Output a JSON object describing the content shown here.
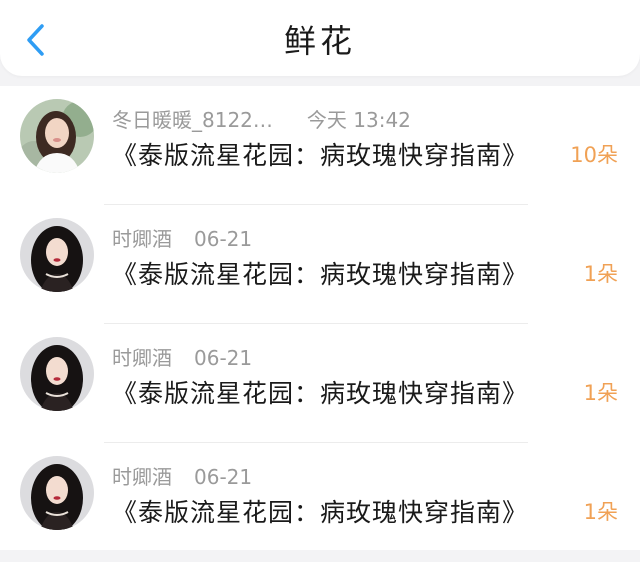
{
  "header": {
    "title": "鲜花",
    "back_icon": "chevron-left-icon",
    "accent_color": "#2f9df4"
  },
  "gifts": [
    {
      "user": "冬日暖暖_8122…",
      "time": "今天 13:42",
      "book": "《泰版流星花园：病玫瑰快穿指南》",
      "count": "10朵"
    },
    {
      "user": "时卿酒",
      "time": "06-21",
      "book": "《泰版流星花园：病玫瑰快穿指南》",
      "count": "1朵"
    },
    {
      "user": "时卿酒",
      "time": "06-21",
      "book": "《泰版流星花园：病玫瑰快穿指南》",
      "count": "1朵"
    },
    {
      "user": "时卿酒",
      "time": "06-21",
      "book": "《泰版流星花园：病玫瑰快穿指南》",
      "count": "1朵"
    }
  ],
  "colors": {
    "count": "#f0a155",
    "meta": "#9a9a9a"
  }
}
